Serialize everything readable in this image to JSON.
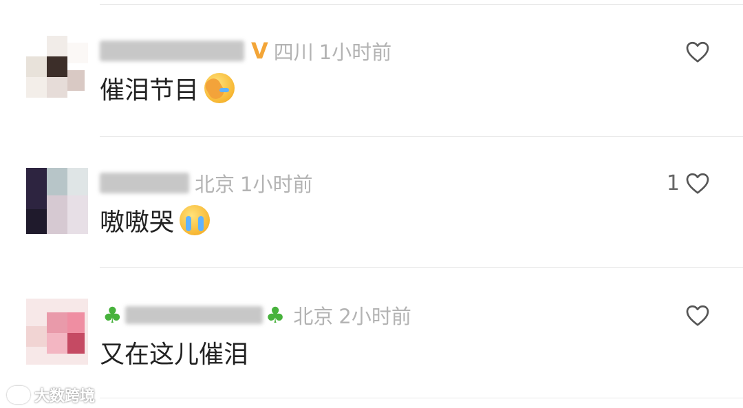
{
  "comments": [
    {
      "region": "四川",
      "time": "1小时前",
      "text": "催泪节目",
      "emoji_icon": "facepalm-crying-emoji",
      "likes": ""
    },
    {
      "region": "北京",
      "time": "1小时前",
      "text": "嗷嗷哭",
      "emoji_icon": "loudly-crying-emoji",
      "likes": "1"
    },
    {
      "region": "北京",
      "time": "2小时前",
      "text": "又在这儿催泪",
      "emoji_icon": "",
      "likes": ""
    }
  ],
  "watermark": {
    "text": "大数跨境"
  },
  "colors": {
    "heart_stroke": "#555555",
    "meta_gray": "#b3b3b3",
    "text": "#222222",
    "badge": "#f3a537",
    "shamrock": "#47b23c"
  }
}
